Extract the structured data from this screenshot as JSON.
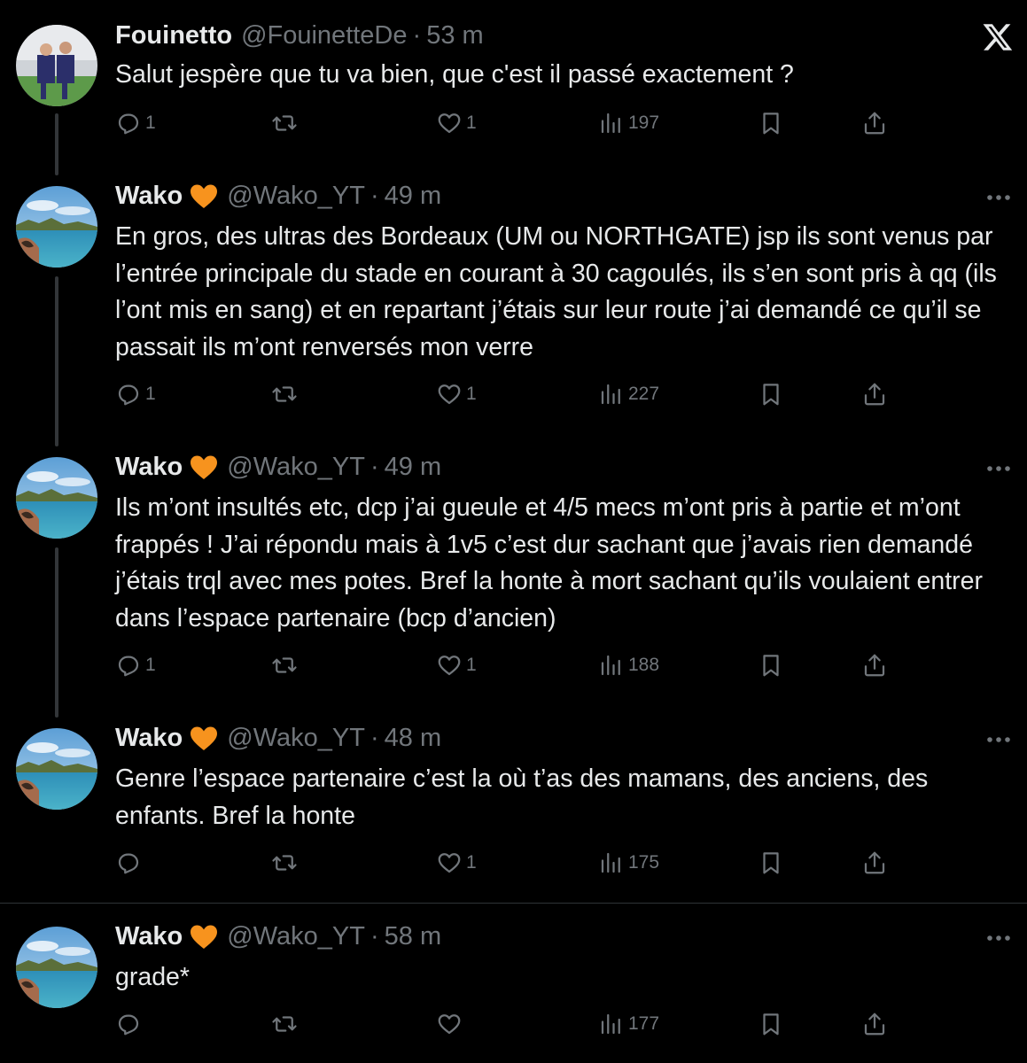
{
  "brand": {
    "logo": "x-logo-icon"
  },
  "tweets": [
    {
      "name": "Fouinetto",
      "handle": "@FouinetteDe",
      "sep": "·",
      "time": "53 m",
      "text": "Salut jespère que tu va bien, que c'est il passé exactement ?",
      "replies": "1",
      "reposts": "",
      "likes": "1",
      "views": "197"
    },
    {
      "name": "Wako",
      "handle": "@Wako_YT",
      "sep": "·",
      "time": "49 m",
      "text": "En gros, des ultras des Bordeaux (UM ou NORTHGATE) jsp ils sont venus par l’entrée principale du stade en courant à 30 cagoulés, ils s’en sont pris à qq (ils l’ont mis en sang) et en repartant j’étais sur leur route j’ai demandé ce qu’il se passait ils m’ont renversés mon verre",
      "replies": "1",
      "reposts": "",
      "likes": "1",
      "views": "227"
    },
    {
      "name": "Wako",
      "handle": "@Wako_YT",
      "sep": "·",
      "time": "49 m",
      "text": "Ils m’ont insultés etc, dcp j’ai gueule et 4/5 mecs m’ont pris à partie et m’ont frappés ! J’ai répondu mais à 1v5 c’est dur sachant que j’avais rien demandé j’étais trql avec mes potes. Bref la honte à mort sachant qu’ils voulaient entrer dans l’espace partenaire (bcp d’ancien)",
      "replies": "1",
      "reposts": "",
      "likes": "1",
      "views": "188"
    },
    {
      "name": "Wako",
      "handle": "@Wako_YT",
      "sep": "·",
      "time": "48 m",
      "text": "Genre l’espace partenaire c’est la où t’as des mamans, des anciens, des enfants. Bref la honte",
      "replies": "",
      "reposts": "",
      "likes": "1",
      "views": "175"
    },
    {
      "name": "Wako",
      "handle": "@Wako_YT",
      "sep": "·",
      "time": "58 m",
      "text": "grade*",
      "replies": "",
      "reposts": "",
      "likes": "",
      "views": "177"
    }
  ],
  "colors": {
    "background": "#000000",
    "text": "#e7e9ea",
    "muted": "#71767b",
    "heart_badge": "#f7931e"
  }
}
